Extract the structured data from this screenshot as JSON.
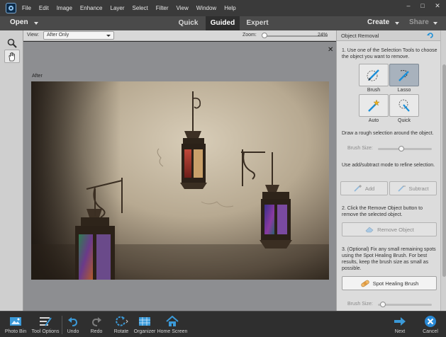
{
  "menubar": {
    "items": [
      "File",
      "Edit",
      "Image",
      "Enhance",
      "Layer",
      "Select",
      "Filter",
      "View",
      "Window",
      "Help"
    ],
    "minimize": "–",
    "maximize": "□",
    "close": "✕"
  },
  "modebar": {
    "open_label": "Open",
    "tabs": [
      {
        "label": "Quick",
        "active": false
      },
      {
        "label": "Guided",
        "active": true
      },
      {
        "label": "Expert",
        "active": false
      }
    ],
    "create_label": "Create",
    "share_label": "Share"
  },
  "viewbar": {
    "view_label": "View:",
    "view_value": "After Only",
    "zoom_label": "Zoom:",
    "zoom_value": "24%",
    "zoom_level": 0.02
  },
  "canvas": {
    "close_symbol": "✕",
    "after_label": "After"
  },
  "panel": {
    "title": "Object Removal",
    "step1": "1. Use one of the Selection Tools to choose the object you want to remove.",
    "tools": [
      {
        "label": "Brush",
        "icon": "brush-icon",
        "active": false
      },
      {
        "label": "Lasso",
        "icon": "lasso-icon",
        "active": true
      },
      {
        "label": "Auto",
        "icon": "magic-wand-icon",
        "active": false
      },
      {
        "label": "Quick",
        "icon": "quick-selection-icon",
        "active": false
      }
    ],
    "rough_selection": "Draw a rough selection around the object.",
    "brush_size_label": "Brush Size:",
    "brush_size_level": 0.4,
    "refine_text": "Use add/subtract mode to refine selection.",
    "add_label": "Add",
    "subtract_label": "Subtract",
    "step2": "2. Click the Remove Object button to remove the selected object.",
    "remove_label": "Remove Object",
    "step3": "3. (Optional) Fix any small remaining spots using the Spot Healing Brush. For best results, keep the brush size as small as possible.",
    "spot_heal_label": "Spot Healing Brush",
    "brush_size_label_2": "Brush Size:",
    "brush_size_level_2": 0.1
  },
  "bottombar": {
    "photo_bin": "Photo Bin",
    "tool_options": "Tool Options",
    "undo": "Undo",
    "redo": "Redo",
    "rotate": "Rotate",
    "organizer": "Organizer",
    "home_screen": "Home Screen",
    "next": "Next",
    "cancel": "Cancel"
  },
  "colors": {
    "accent_blue": "#1b8fd8",
    "cancel_blue": "#2a8ad6"
  }
}
